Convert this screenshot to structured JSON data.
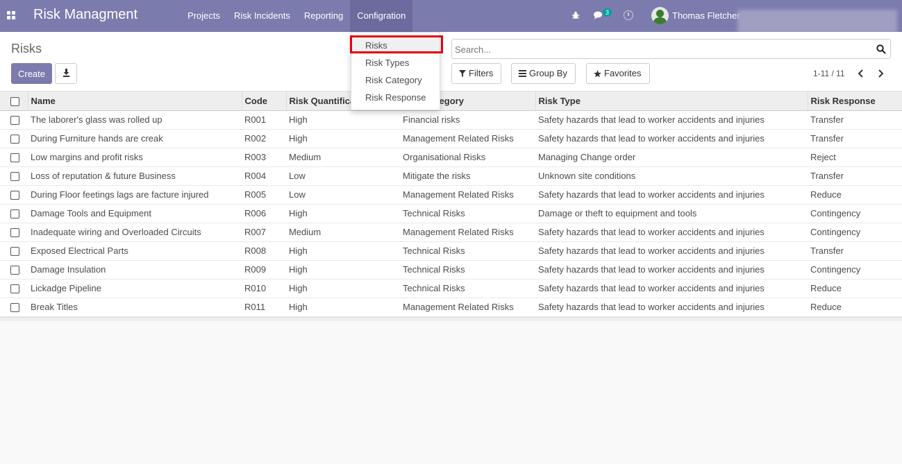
{
  "navbar": {
    "brand": "Risk Managment",
    "menu": [
      {
        "label": "Projects"
      },
      {
        "label": "Risk Incidents"
      },
      {
        "label": "Reporting"
      },
      {
        "label": "Configration"
      }
    ],
    "chat_badge": "3",
    "user_name": "Thomas Fletcher"
  },
  "control_panel": {
    "title": "Risks",
    "create_label": "Create",
    "search_placeholder": "Search...",
    "filters_label": "Filters",
    "group_by_label": "Group By",
    "favorites_label": "Favorites",
    "pager": "1-11 / 11"
  },
  "dropdown": {
    "items": [
      {
        "label": "Risks"
      },
      {
        "label": "Risk Types"
      },
      {
        "label": "Risk Category"
      },
      {
        "label": "Risk Response"
      }
    ]
  },
  "table": {
    "headers": [
      "Name",
      "Code",
      "Risk Quantification",
      "Risk Category",
      "Risk Type",
      "Risk Response"
    ],
    "rows": [
      [
        "The laborer's glass was rolled up",
        "R001",
        "High",
        "Financial risks",
        "Safety hazards that lead to worker accidents and injuries",
        "Transfer"
      ],
      [
        "During Furniture hands are creak",
        "R002",
        "High",
        "Management Related Risks",
        "Safety hazards that lead to worker accidents and injuries",
        "Transfer"
      ],
      [
        "Low margins and profit risks",
        "R003",
        "Medium",
        "Organisational Risks",
        "Managing Change order",
        "Reject"
      ],
      [
        "Loss of reputation & future Business",
        "R004",
        "Low",
        "Mitigate the risks",
        "Unknown site conditions",
        "Transfer"
      ],
      [
        "During Floor feetings lags are facture injured",
        "R005",
        "Low",
        "Management Related Risks",
        "Safety hazards that lead to worker accidents and injuries",
        "Reduce"
      ],
      [
        "Damage Tools and Equipment",
        "R006",
        "High",
        "Technical Risks",
        "Damage or theft to equipment and tools",
        "Contingency"
      ],
      [
        "Inadequate wiring and Overloaded Circuits",
        "R007",
        "Medium",
        "Management Related Risks",
        "Safety hazards that lead to worker accidents and injuries",
        "Contingency"
      ],
      [
        "Exposed Electrical Parts",
        "R008",
        "High",
        "Technical Risks",
        "Safety hazards that lead to worker accidents and injuries",
        "Transfer"
      ],
      [
        "Damage Insulation",
        "R009",
        "High",
        "Technical Risks",
        "Safety hazards that lead to worker accidents and injuries",
        "Contingency"
      ],
      [
        "Lickadge Pipeline",
        "R010",
        "High",
        "Technical Risks",
        "Safety hazards that lead to worker accidents and injuries",
        "Reduce"
      ],
      [
        "Break Titles",
        "R011",
        "High",
        "Management Related Risks",
        "Safety hazards that lead to worker accidents and injuries",
        "Reduce"
      ]
    ]
  },
  "colors": {
    "brand": "#7c7bad",
    "highlight_border": "#e4000f",
    "badge": "#00a09d"
  }
}
